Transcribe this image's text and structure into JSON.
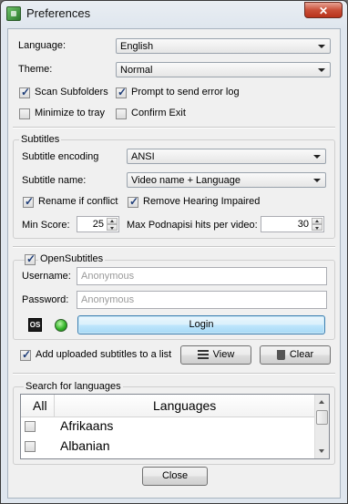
{
  "window": {
    "title": "Preferences",
    "close_glyph": "✕"
  },
  "general": {
    "language_label": "Language:",
    "language_value": "English",
    "theme_label": "Theme:",
    "theme_value": "Normal",
    "scan_subfolders": {
      "label": "Scan Subfolders",
      "checked": true
    },
    "prompt_error_log": {
      "label": "Prompt to send error log",
      "checked": true
    },
    "minimize_tray": {
      "label": "Minimize to tray",
      "checked": false
    },
    "confirm_exit": {
      "label": "Confirm Exit",
      "checked": false
    }
  },
  "subtitles": {
    "group_title": "Subtitles",
    "encoding_label": "Subtitle encoding",
    "encoding_value": "ANSI",
    "name_label": "Subtitle name:",
    "name_value": "Video name + Language",
    "rename_conflict": {
      "label": "Rename if conflict",
      "checked": true
    },
    "remove_hi": {
      "label": "Remove Hearing Impaired",
      "checked": true
    },
    "min_score_label": "Min Score:",
    "min_score_value": "25",
    "max_hits_label": "Max Podnapisi hits per video:",
    "max_hits_value": "30"
  },
  "opensubtitles": {
    "label": "OpenSubtitles",
    "checked": true,
    "username_label": "Username:",
    "username_placeholder": "Anonymous",
    "password_label": "Password:",
    "password_placeholder": "Anonymous",
    "login_label": "Login",
    "status_color": "#34b52a"
  },
  "upload": {
    "add_to_list": {
      "label": "Add uploaded subtitles to a list",
      "checked": true
    },
    "view_label": "View",
    "clear_label": "Clear"
  },
  "languages": {
    "group_title": "Search for languages",
    "col_all": "All",
    "col_languages": "Languages",
    "rows": [
      {
        "name": "Afrikaans",
        "checked": false
      },
      {
        "name": "Albanian",
        "checked": false
      }
    ]
  },
  "footer": {
    "close_label": "Close"
  },
  "colors": {
    "accent_focus": "#3c7fb1",
    "close_red": "#c94f38"
  }
}
